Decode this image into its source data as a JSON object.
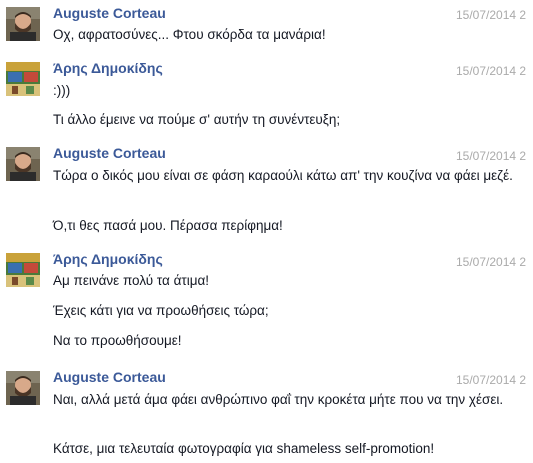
{
  "groups": [
    {
      "author": "Auguste Corteau",
      "avatar": "profile-photo-man-beard",
      "timestamp": "15/07/2014 2",
      "messages": [
        "Οχ, αφρατοσύνες... Φτου σκόρδα τα μανάρια!"
      ]
    },
    {
      "author": "Άρης Δημοκίδης",
      "avatar": "profile-photo-colorful-poster",
      "timestamp": "15/07/2014 2",
      "messages": [
        ":)))",
        "Τι άλλο έμεινε να πούμε σ' αυτήν τη συνέντευξη;"
      ]
    },
    {
      "author": "Auguste Corteau",
      "avatar": "profile-photo-man-beard",
      "timestamp": "15/07/2014 2",
      "messages": [
        "Τώρα ο δικός μου είναι σε φάση καραούλι κάτω απ' την κουζίνα να φάει μεζέ.",
        "Ό,τι θες πασά μου. Πέρασα περίφημα!"
      ]
    },
    {
      "author": "Άρης Δημοκίδης",
      "avatar": "profile-photo-colorful-poster",
      "timestamp": "15/07/2014 2",
      "messages": [
        "Αμ πεινάνε πολύ τα άτιμα!",
        "Έχεις κάτι για να προωθήσεις τώρα;",
        "Να το προωθήσουμε!"
      ]
    },
    {
      "author": "Auguste Corteau",
      "avatar": "profile-photo-man-beard",
      "timestamp": "15/07/2014 2",
      "messages": [
        "Ναι, αλλά μετά άμα φάει ανθρώπινο φαΐ την κροκέτα μήτε που να την χέσει.",
        "Κάτσε, μια τελευταία φωτογραφία για shameless self-promotion!"
      ]
    }
  ]
}
